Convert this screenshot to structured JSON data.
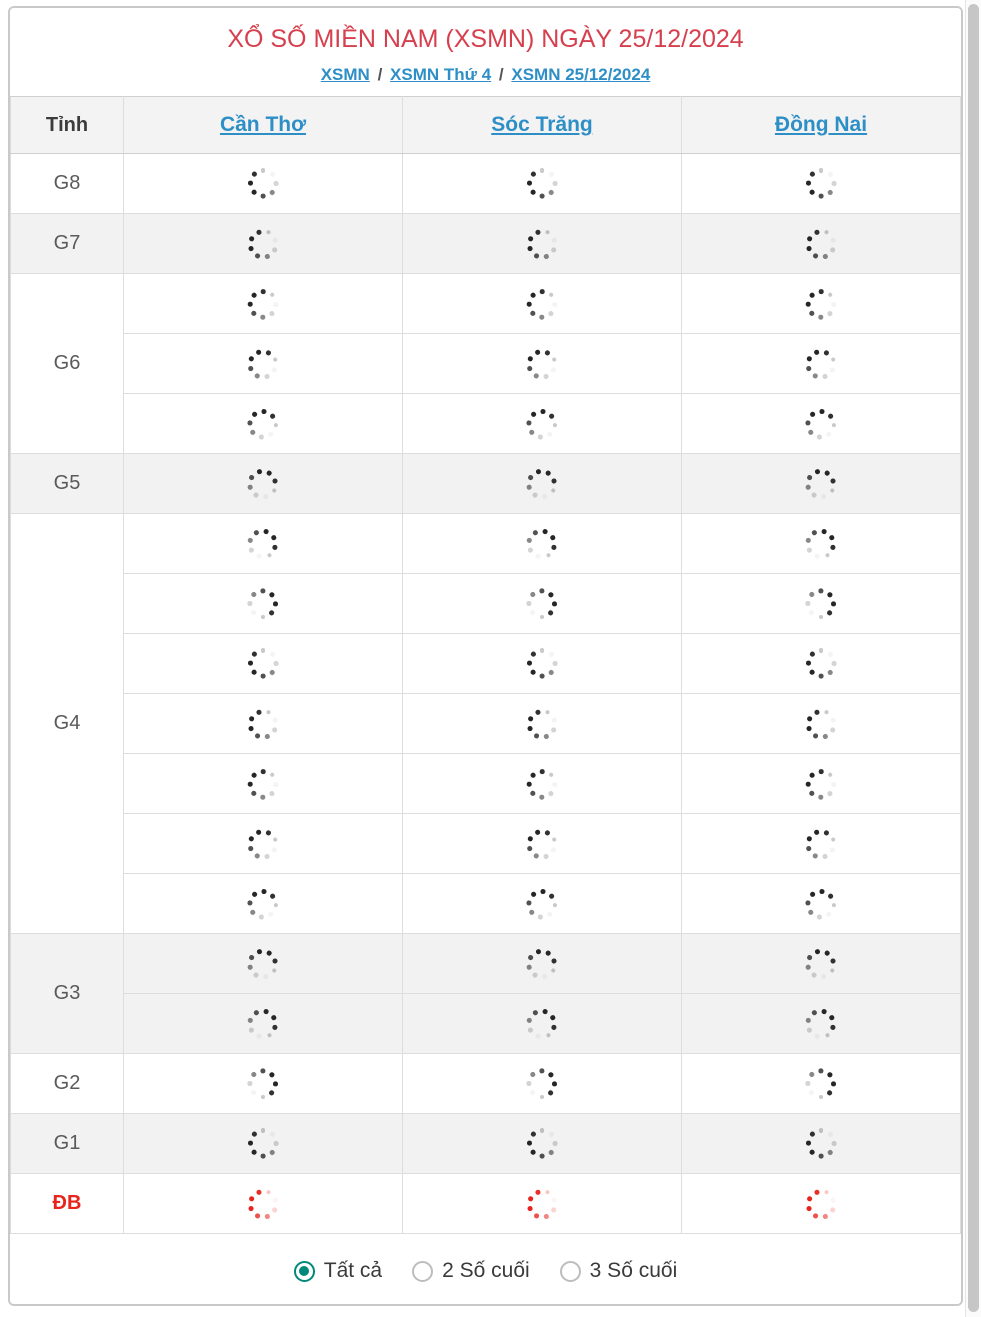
{
  "header": {
    "title": "XỔ SỐ MIỀN NAM (XSMN) NGÀY 25/12/2024",
    "title_color": "#d6404e",
    "breadcrumb": {
      "items": [
        "XSMN",
        "XSMN Thứ 4",
        "XSMN 25/12/2024"
      ],
      "separator": "/",
      "link_color": "#2e8fc7"
    }
  },
  "table": {
    "columns": [
      {
        "label": "Tỉnh",
        "is_link": false
      },
      {
        "label": "Cần Thơ",
        "is_link": true
      },
      {
        "label": "Sóc Trăng",
        "is_link": true
      },
      {
        "label": "Đồng Nai",
        "is_link": true
      }
    ],
    "loading_icon": "spinner-icon",
    "prize_rows": [
      {
        "label": "G8",
        "rows": 1,
        "shaded": false,
        "highlight": false
      },
      {
        "label": "G7",
        "rows": 1,
        "shaded": true,
        "highlight": false
      },
      {
        "label": "G6",
        "rows": 3,
        "shaded": false,
        "highlight": false
      },
      {
        "label": "G5",
        "rows": 1,
        "shaded": true,
        "highlight": false
      },
      {
        "label": "G4",
        "rows": 7,
        "shaded": false,
        "highlight": false
      },
      {
        "label": "G3",
        "rows": 2,
        "shaded": true,
        "highlight": false
      },
      {
        "label": "G2",
        "rows": 1,
        "shaded": false,
        "highlight": false
      },
      {
        "label": "G1",
        "rows": 1,
        "shaded": true,
        "highlight": false
      },
      {
        "label": "ĐB",
        "rows": 1,
        "shaded": false,
        "highlight": true
      }
    ],
    "highlight_color": "#e8251c"
  },
  "footer": {
    "options": [
      {
        "label": "Tất cả",
        "selected": true
      },
      {
        "label": "2 Số cuối",
        "selected": false
      },
      {
        "label": "3 Số cuối",
        "selected": false
      }
    ],
    "selected_color": "#00897b"
  }
}
